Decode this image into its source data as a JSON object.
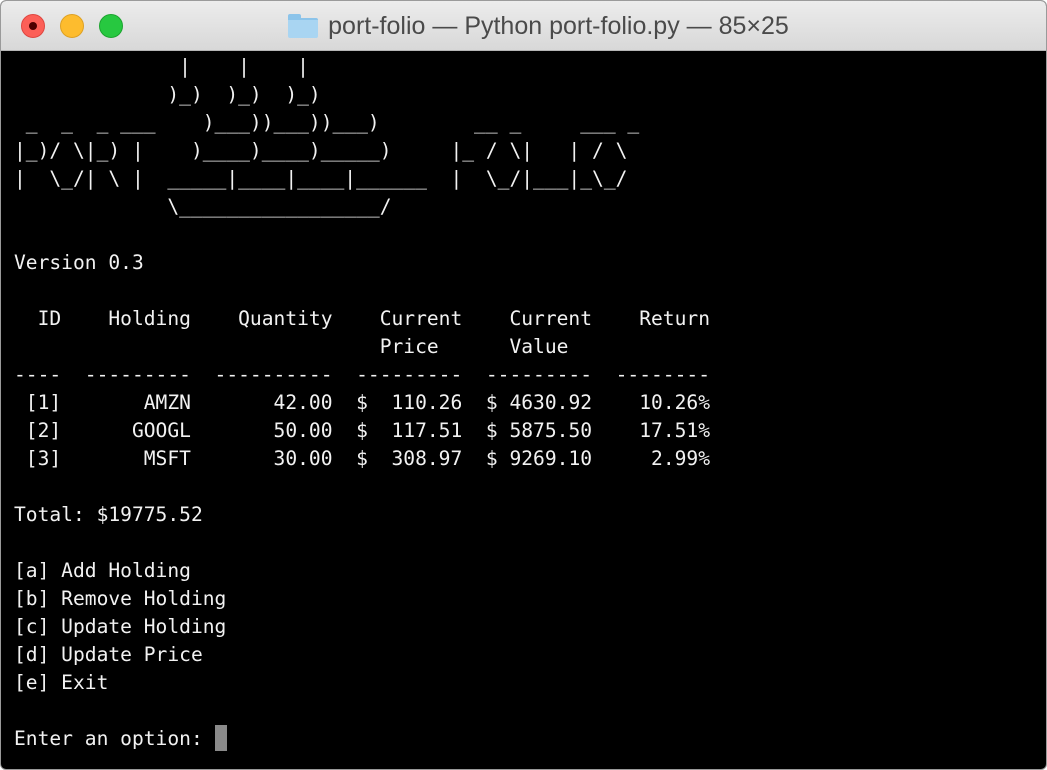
{
  "window": {
    "title": "port-folio — Python port-folio.py — 85×25",
    "folder_icon": "folder-icon"
  },
  "banner": {
    "lines": [
      "              |    |    |",
      "             )_)  )_)  )_)",
      " _  _  _ ___    )___))___))___)        __ _     ___ _",
      "|_)/ \\|_) |    )____)____)_____)     |_ / \\|   | / \\",
      "|  \\_/| \\ |  _____|____|____|______  |  \\_/|___|_\\_/",
      "             \\_________________/"
    ]
  },
  "version": "Version 0.3",
  "table": {
    "header_line_1": "  ID    Holding    Quantity    Current    Current    Return",
    "header_line_2": "                               Price      Value",
    "separator": "----  ---------  ----------  ---------  ---------  --------",
    "rows": [
      {
        "id": "[1]",
        "holding": "AMZN",
        "quantity": "42.00",
        "price": "$  110.26",
        "value": "$ 4630.92",
        "return": "10.26%"
      },
      {
        "id": "[2]",
        "holding": "GOOGL",
        "quantity": "50.00",
        "price": "$  117.51",
        "value": "$ 5875.50",
        "return": "17.51%"
      },
      {
        "id": "[3]",
        "holding": "MSFT",
        "quantity": "30.00",
        "price": "$  308.97",
        "value": "$ 9269.10",
        "return": "2.99%"
      }
    ]
  },
  "total": "Total: $19775.52",
  "menu": {
    "items": [
      "[a] Add Holding",
      "[b] Remove Holding",
      "[c] Update Holding",
      "[d] Update Price",
      "[e] Exit"
    ]
  },
  "prompt": "Enter an option: "
}
